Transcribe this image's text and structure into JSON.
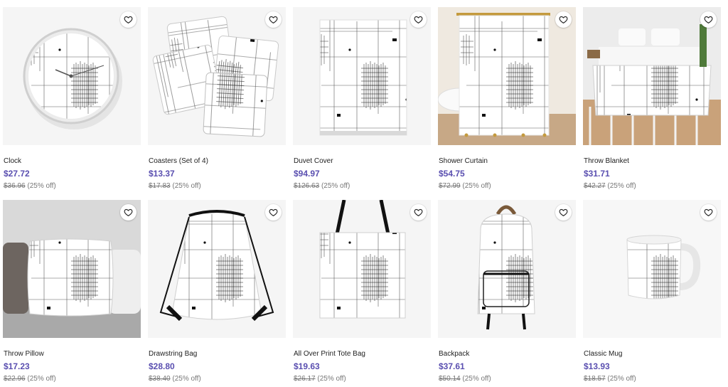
{
  "products": [
    {
      "name": "Clock",
      "price": "$27.72",
      "was": "$36.96",
      "discount": "(25% off)",
      "icon": "clock"
    },
    {
      "name": "Coasters (Set of 4)",
      "price": "$13.37",
      "was": "$17.83",
      "discount": "(25% off)",
      "icon": "coasters"
    },
    {
      "name": "Duvet Cover",
      "price": "$94.97",
      "was": "$126.63",
      "discount": "(25% off)",
      "icon": "duvet"
    },
    {
      "name": "Shower Curtain",
      "price": "$54.75",
      "was": "$72.99",
      "discount": "(25% off)",
      "icon": "curtain"
    },
    {
      "name": "Throw Blanket",
      "price": "$31.71",
      "was": "$42.27",
      "discount": "(25% off)",
      "icon": "blanket"
    },
    {
      "name": "Throw Pillow",
      "price": "$17.23",
      "was": "$22.96",
      "discount": "(25% off)",
      "icon": "pillow"
    },
    {
      "name": "Drawstring Bag",
      "price": "$28.80",
      "was": "$38.40",
      "discount": "(25% off)",
      "icon": "drawstring"
    },
    {
      "name": "All Over Print Tote Bag",
      "price": "$19.63",
      "was": "$26.17",
      "discount": "(25% off)",
      "icon": "tote"
    },
    {
      "name": "Backpack",
      "price": "$37.61",
      "was": "$50.14",
      "discount": "(25% off)",
      "icon": "backpack"
    },
    {
      "name": "Classic Mug",
      "price": "$13.93",
      "was": "$18.57",
      "discount": "(25% off)",
      "icon": "mug"
    }
  ],
  "favorite_icon": "heart-outline-icon",
  "colors": {
    "price": "#5a4fb0",
    "old_price": "#777777",
    "thumb_bg": "#f5f5f5"
  }
}
